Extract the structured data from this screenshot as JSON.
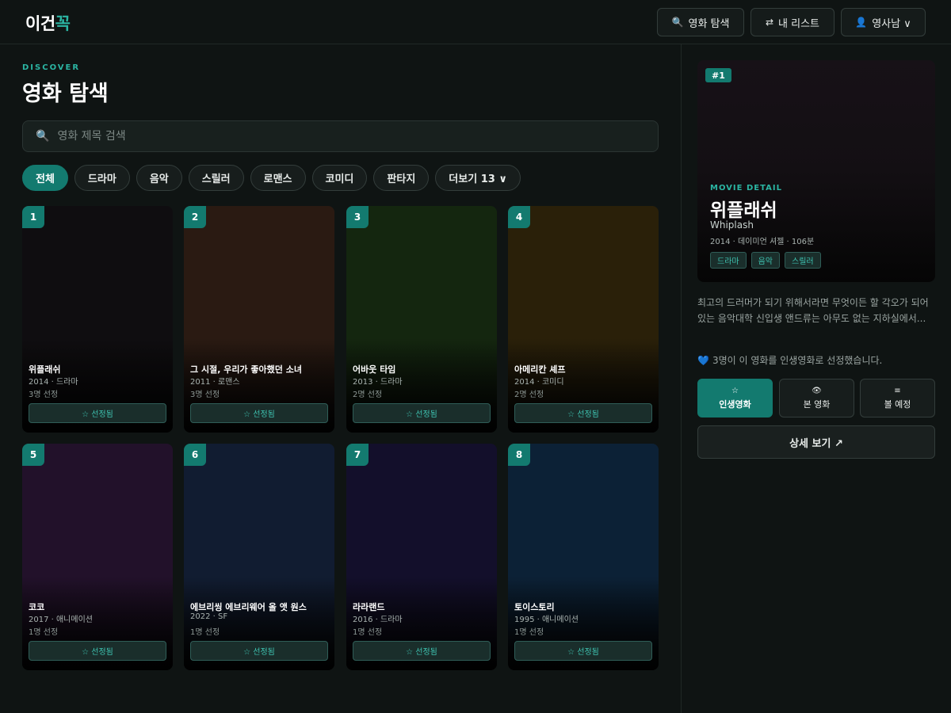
{
  "header": {
    "logo_main": "이건",
    "logo_accent": "꼭",
    "search_label": "영화 탐색",
    "list_label": "내 리스트",
    "user_label": "영사남 ∨"
  },
  "main": {
    "eyebrow": "DISCOVER",
    "title": "영화 탐색",
    "search_placeholder": "영화 제목 검색",
    "chips": [
      "전체",
      "드라마",
      "음악",
      "스릴러",
      "로맨스",
      "코미디",
      "판타지",
      "더보기 13 ∨"
    ],
    "active_chip": "전체",
    "movies": [
      {
        "rank": "1",
        "title": "위플래쉬",
        "meta": "2014 · 드라마",
        "count": "3명 선정",
        "button": "☆ 선정됨",
        "color": "#0f0d10"
      },
      {
        "rank": "2",
        "title": "그 시절, 우리가 좋아했던 소녀",
        "meta": "2011 · 로맨스",
        "count": "3명 선정",
        "button": "☆ 선정됨",
        "color": "#2a1a12"
      },
      {
        "rank": "3",
        "title": "어바웃 타임",
        "meta": "2013 · 드라마",
        "count": "2명 선정",
        "button": "☆ 선정됨",
        "color": "#14260f"
      },
      {
        "rank": "4",
        "title": "아메리칸 셰프",
        "meta": "2014 · 코미디",
        "count": "2명 선정",
        "button": "☆ 선정됨",
        "color": "#2a2009"
      },
      {
        "rank": "5",
        "title": "코코",
        "meta": "2017 · 애니메이션",
        "count": "1명 선정",
        "button": "☆ 선정됨",
        "color": "#22112a"
      },
      {
        "rank": "6",
        "title": "에브리씽 에브리웨어 올 앳 원스",
        "meta": "2022 · SF",
        "count": "1명 선정",
        "button": "☆ 선정됨",
        "color": "#111c31"
      },
      {
        "rank": "7",
        "title": "라라랜드",
        "meta": "2016 · 드라마",
        "count": "1명 선정",
        "button": "☆ 선정됨",
        "color": "#130f2b"
      },
      {
        "rank": "8",
        "title": "토이스토리",
        "meta": "1995 · 애니메이션",
        "count": "1명 선정",
        "button": "☆ 선정됨",
        "color": "#0c2136"
      }
    ]
  },
  "detail": {
    "badge": "#1",
    "eyebrow": "MOVIE DETAIL",
    "title": "위플래쉬",
    "original_title": "Whiplash",
    "info": "2014 · 데이미언 셔젤 · 106분",
    "tags": [
      "드라마",
      "음악",
      "스릴러"
    ],
    "description": "최고의 드러머가 되기 위해서라면 무엇이든 할 각오가 되어있는 음악대학 신입생 앤드류는 아무도 없는 지하실에서...",
    "heart": "💙",
    "stat": "3명이 이 영화를 인생영화로 선정했습니다.",
    "actions": [
      {
        "icon": "☆",
        "label": "인생영화",
        "active": true
      },
      {
        "icon": "👁",
        "label": "본 영화",
        "active": false
      },
      {
        "icon": "≡",
        "label": "볼 예정",
        "active": false
      }
    ],
    "detail_button": "상세 보기 ↗"
  }
}
